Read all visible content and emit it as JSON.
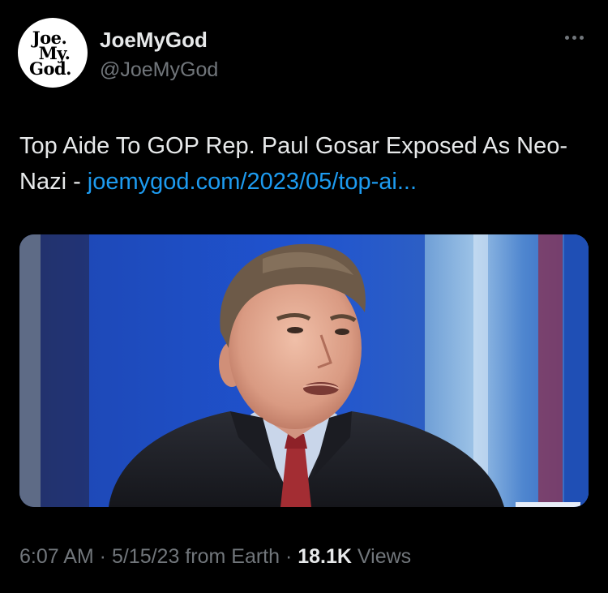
{
  "author": {
    "display_name": "JoeMyGod",
    "handle": "@JoeMyGod",
    "avatar_logo_lines": [
      "Joe.",
      "My.",
      "God."
    ]
  },
  "tweet": {
    "text": "Top Aide To GOP Rep. Paul Gosar Exposed As Neo-Nazi - ",
    "link_text": "joemygod.com/2023/05/top-ai..."
  },
  "meta": {
    "time": "6:07 AM",
    "sep1": " · ",
    "date": "5/15/23",
    "source": " from Earth",
    "sep2": " · ",
    "views_count": "18.1K",
    "views_label": " Views"
  },
  "icons": {
    "more": "more-horizontal-icon"
  },
  "colors": {
    "background": "#000000",
    "text": "#e7e9ea",
    "secondary": "#71767b",
    "link": "#1d9bf0"
  }
}
